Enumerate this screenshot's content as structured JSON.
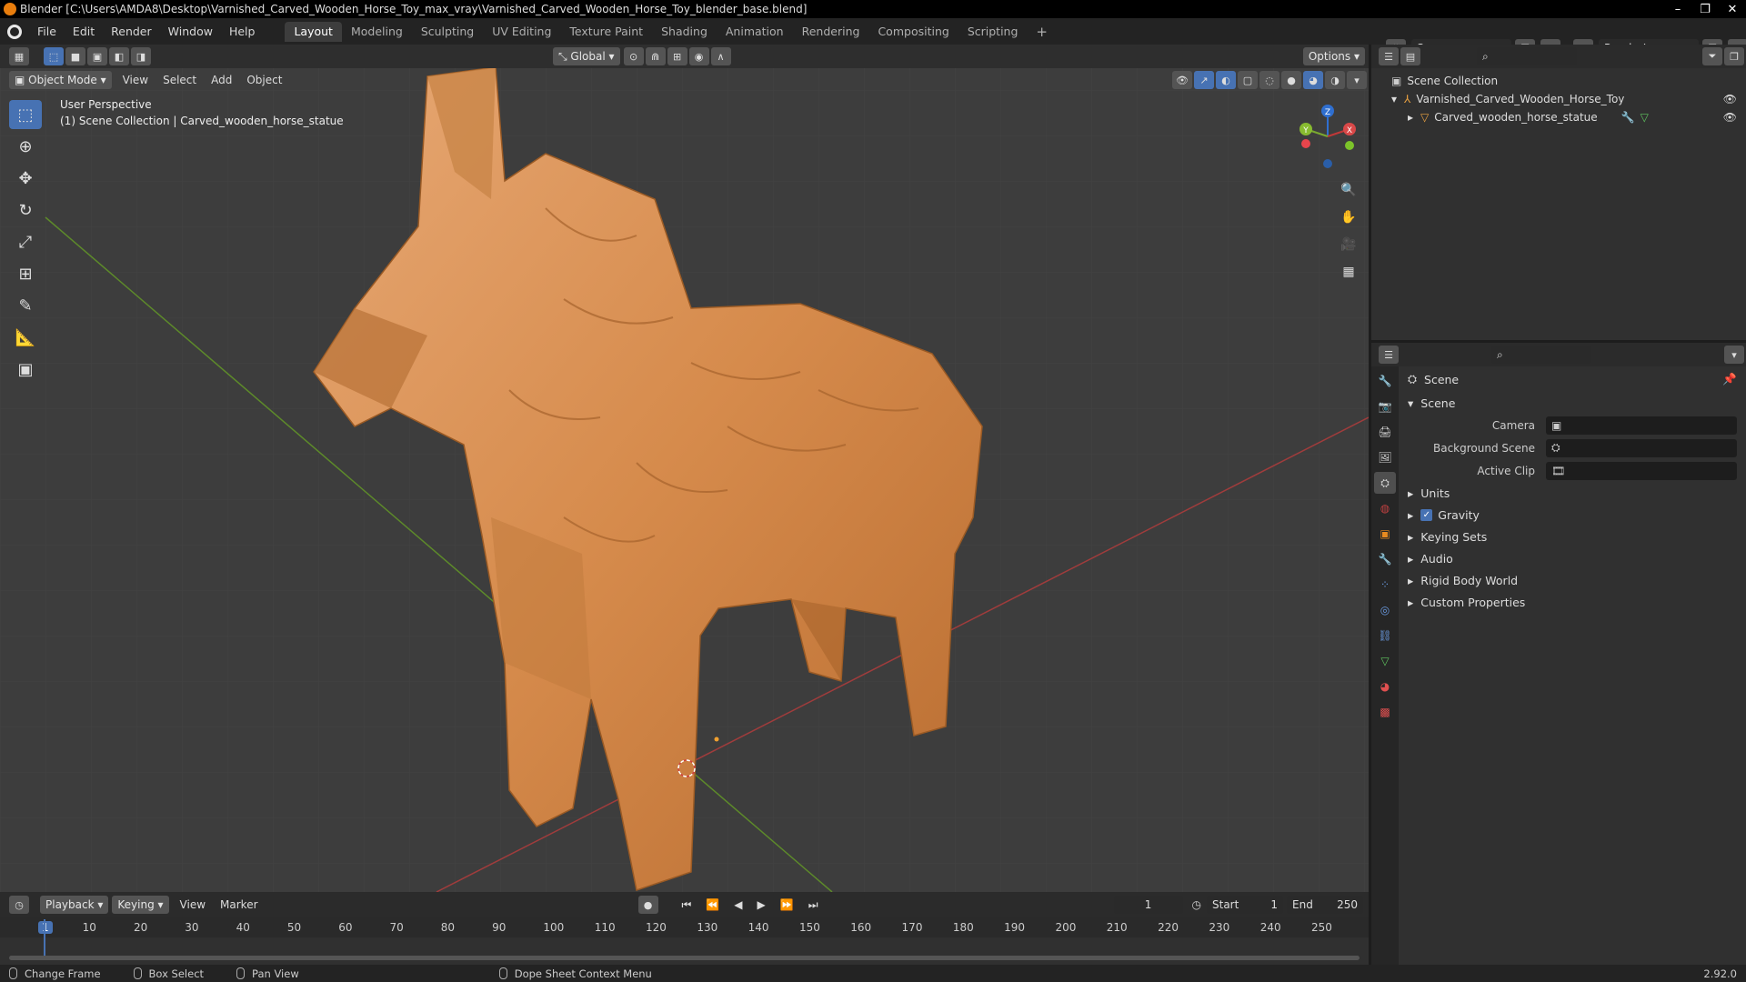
{
  "window": {
    "title": "Blender [C:\\Users\\AMDA8\\Desktop\\Varnished_Carved_Wooden_Horse_Toy_max_vray\\Varnished_Carved_Wooden_Horse_Toy_blender_base.blend]"
  },
  "menu": [
    "File",
    "Edit",
    "Render",
    "Window",
    "Help"
  ],
  "workspaces": [
    "Layout",
    "Modeling",
    "Sculpting",
    "UV Editing",
    "Texture Paint",
    "Shading",
    "Animation",
    "Rendering",
    "Compositing",
    "Scripting"
  ],
  "active_workspace": "Layout",
  "scene_field": "Scene",
  "renderlayer_field": "RenderLayer",
  "viewport": {
    "orientation": "Global",
    "options_label": "Options",
    "mode": "Object Mode",
    "menus": [
      "View",
      "Select",
      "Add",
      "Object"
    ],
    "info_line1": "User Perspective",
    "info_line2": "(1) Scene Collection | Carved_wooden_horse_statue",
    "gizmo": {
      "x": "X",
      "y": "Y",
      "z": "Z"
    }
  },
  "outliner": {
    "root": "Scene Collection",
    "collection": "Varnished_Carved_Wooden_Horse_Toy",
    "object": "Carved_wooden_horse_statue"
  },
  "properties": {
    "header": "Scene",
    "section": "Scene",
    "fields": [
      {
        "label": "Camera",
        "value": ""
      },
      {
        "label": "Background Scene",
        "value": ""
      },
      {
        "label": "Active Clip",
        "value": ""
      }
    ],
    "panels": [
      "Units",
      "Gravity",
      "Keying Sets",
      "Audio",
      "Rigid Body World",
      "Custom Properties"
    ],
    "gravity_checked": true
  },
  "timeline": {
    "menus": [
      "Playback",
      "Keying",
      "View",
      "Marker"
    ],
    "current_frame": "1",
    "start_label": "Start",
    "start": "1",
    "end_label": "End",
    "end": "250",
    "ticks": [
      "1",
      "10",
      "20",
      "30",
      "40",
      "50",
      "60",
      "70",
      "80",
      "90",
      "100",
      "110",
      "120",
      "130",
      "140",
      "150",
      "160",
      "170",
      "180",
      "190",
      "200",
      "210",
      "220",
      "230",
      "240",
      "250"
    ]
  },
  "statusbar": {
    "items": [
      "Change Frame",
      "Box Select",
      "Pan View",
      "Dope Sheet Context Menu"
    ],
    "version": "2.92.0"
  },
  "colors": {
    "accent": "#4772b3",
    "orange": "#e87d0d",
    "wood": "#d08a4c",
    "axis_x": "#c04040",
    "axis_y": "#6a9a2a"
  }
}
